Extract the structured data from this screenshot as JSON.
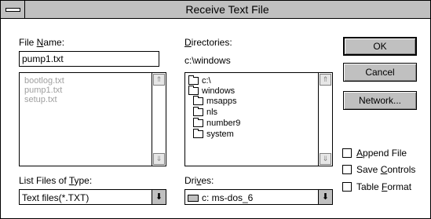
{
  "title": "Receive Text File",
  "file_name": {
    "label_pre": "File ",
    "label_u": "N",
    "label_post": "ame:",
    "value": "pump1.txt",
    "files": [
      "bootlog.txt",
      "pump1.txt",
      "setup.txt"
    ]
  },
  "directories": {
    "label_pre": "",
    "label_u": "D",
    "label_post": "irectories:",
    "current": "c:\\windows",
    "tree": [
      {
        "name": "c:\\",
        "icon": "open-folder-icon",
        "depth": 0
      },
      {
        "name": "windows",
        "icon": "open-folder-icon",
        "depth": 1
      },
      {
        "name": "msapps",
        "icon": "folder-icon",
        "depth": 2
      },
      {
        "name": "nls",
        "icon": "folder-icon",
        "depth": 2
      },
      {
        "name": "number9",
        "icon": "folder-icon",
        "depth": 2
      },
      {
        "name": "system",
        "icon": "folder-icon",
        "depth": 2
      }
    ]
  },
  "file_type": {
    "label_pre": "List Files of ",
    "label_u": "T",
    "label_post": "ype:",
    "value": "Text files(*.TXT)"
  },
  "drives": {
    "label_pre": "Dri",
    "label_u": "v",
    "label_post": "es:",
    "value": "c: ms-dos_6"
  },
  "buttons": {
    "ok": "OK",
    "cancel": "Cancel",
    "network": "Network..."
  },
  "options": {
    "append": {
      "pre": "",
      "u": "A",
      "post": "ppend File",
      "checked": false
    },
    "save": {
      "pre": "Save ",
      "u": "C",
      "post": "ontrols",
      "checked": false
    },
    "table": {
      "pre": "Table ",
      "u": "F",
      "post": "ormat",
      "checked": false
    }
  }
}
